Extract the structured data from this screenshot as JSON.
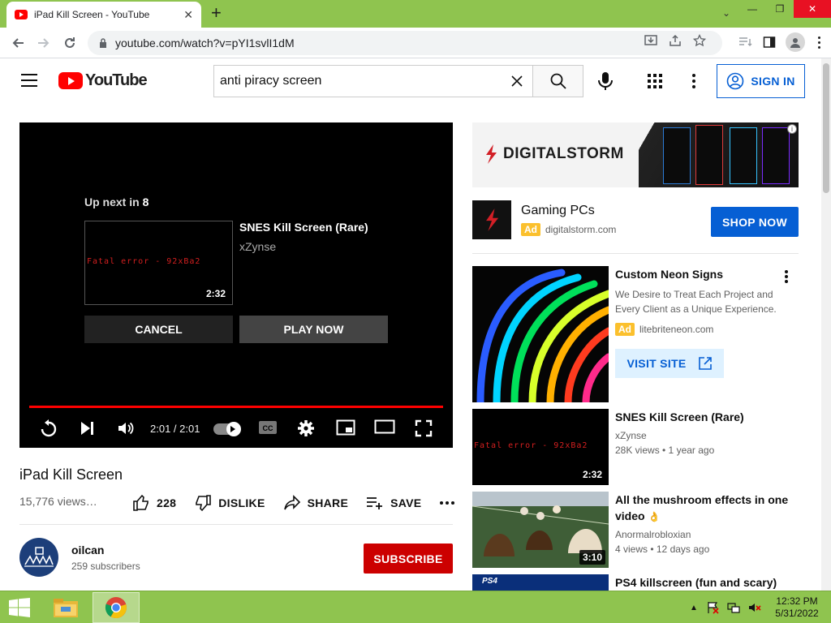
{
  "browser": {
    "tab_title": "iPad Kill Screen - YouTube",
    "url": "youtube.com/watch?v=pYI1svlI1dM"
  },
  "header": {
    "logo_text": "YouTube",
    "search_value": "anti piracy screen",
    "signin_label": "SIGN IN"
  },
  "player": {
    "up_next_prefix": "Up next in",
    "up_next_count": "8",
    "next_title": "SNES Kill Screen (Rare)",
    "next_channel": "xZynse",
    "next_thumb_text": "Fatal error - 92xBa2",
    "next_duration": "2:32",
    "cancel_label": "CANCEL",
    "play_now_label": "PLAY NOW",
    "time": "2:01 / 2:01",
    "progress_fraction": 1.0
  },
  "video": {
    "title": "iPad Kill Screen",
    "views": "15,776 views…",
    "likes": "228",
    "dislike_label": "DISLIKE",
    "share_label": "SHARE",
    "save_label": "SAVE"
  },
  "channel": {
    "name": "oilcan",
    "subscribers": "259 subscribers",
    "subscribe_label": "SUBSCRIBE"
  },
  "ads": {
    "banner_brand": "DIGITALSTORM",
    "ad1_title": "Gaming PCs",
    "ad_badge": "Ad",
    "ad1_site": "digitalstorm.com",
    "ad1_cta": "SHOP NOW",
    "ad2_title": "Custom Neon Signs",
    "ad2_desc": "We Desire to Treat Each Project and Every Client as a Unique Experience.",
    "ad2_site": "litebriteneon.com",
    "ad2_cta": "VISIT SITE"
  },
  "recommendations": [
    {
      "title": "SNES Kill Screen (Rare)",
      "channel": "xZynse",
      "meta": "28K views • 1 year ago",
      "duration": "2:32",
      "thumb_text": "Fatal error - 92xBa2"
    },
    {
      "title": "All the mushroom effects in one video",
      "channel": "Anormalrobloxian",
      "meta": "4 views • 12 days ago",
      "duration": "3:10"
    },
    {
      "title": "PS4 killscreen (fun and scary)",
      "thumb_text": "PS4"
    }
  ],
  "taskbar": {
    "time": "12:32 PM",
    "date": "5/31/2022"
  },
  "colors": {
    "youtube_red": "#ff0000",
    "subscribe_red": "#cc0000",
    "link_blue": "#065fd4",
    "titlebar_green": "#8fc44f",
    "ad_badge": "#fbc02d"
  }
}
